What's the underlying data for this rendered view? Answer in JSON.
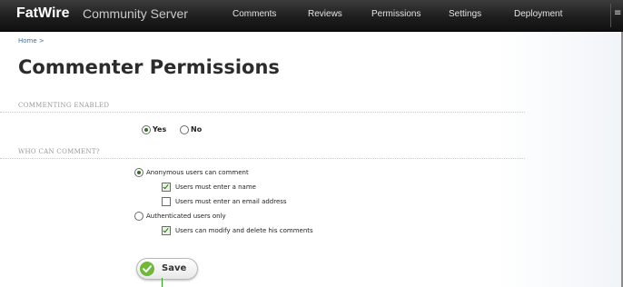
{
  "app": {
    "brand": "FatWire",
    "product": "Community Server"
  },
  "nav": {
    "items": [
      {
        "label": "Comments"
      },
      {
        "label": "Reviews"
      },
      {
        "label": "Permissions"
      },
      {
        "label": "Settings"
      },
      {
        "label": "Deployment"
      }
    ],
    "overflow_glyph": "≡"
  },
  "breadcrumb": {
    "home": "Home",
    "separator": ">"
  },
  "page": {
    "title": "Commenter Permissions"
  },
  "sections": {
    "commenting_enabled": {
      "label": "COMMENTING ENABLED",
      "yes_label": "Yes",
      "no_label": "No",
      "selected": "Yes"
    },
    "who_can_comment": {
      "label": "WHO CAN COMMENT?",
      "anonymous_label": "Anonymous users can comment",
      "require_name_label": "Users must enter a name",
      "require_email_label": "Users must enter an email address",
      "authenticated_label": "Authenticated users only",
      "modify_delete_label": "Users can modify and delete his comments",
      "selected": "Anonymous users can comment",
      "require_name_checked": true,
      "require_email_checked": false,
      "modify_delete_checked": true
    }
  },
  "actions": {
    "save_label": "Save"
  },
  "colors": {
    "topbar": "#1e1e1e",
    "accent_green": "#6fb83a",
    "breadcrumb_link": "#4a6c8f",
    "section_label": "#999999"
  },
  "icons": {
    "save": "checkmark-circle-icon",
    "overflow": "menu-icon"
  }
}
